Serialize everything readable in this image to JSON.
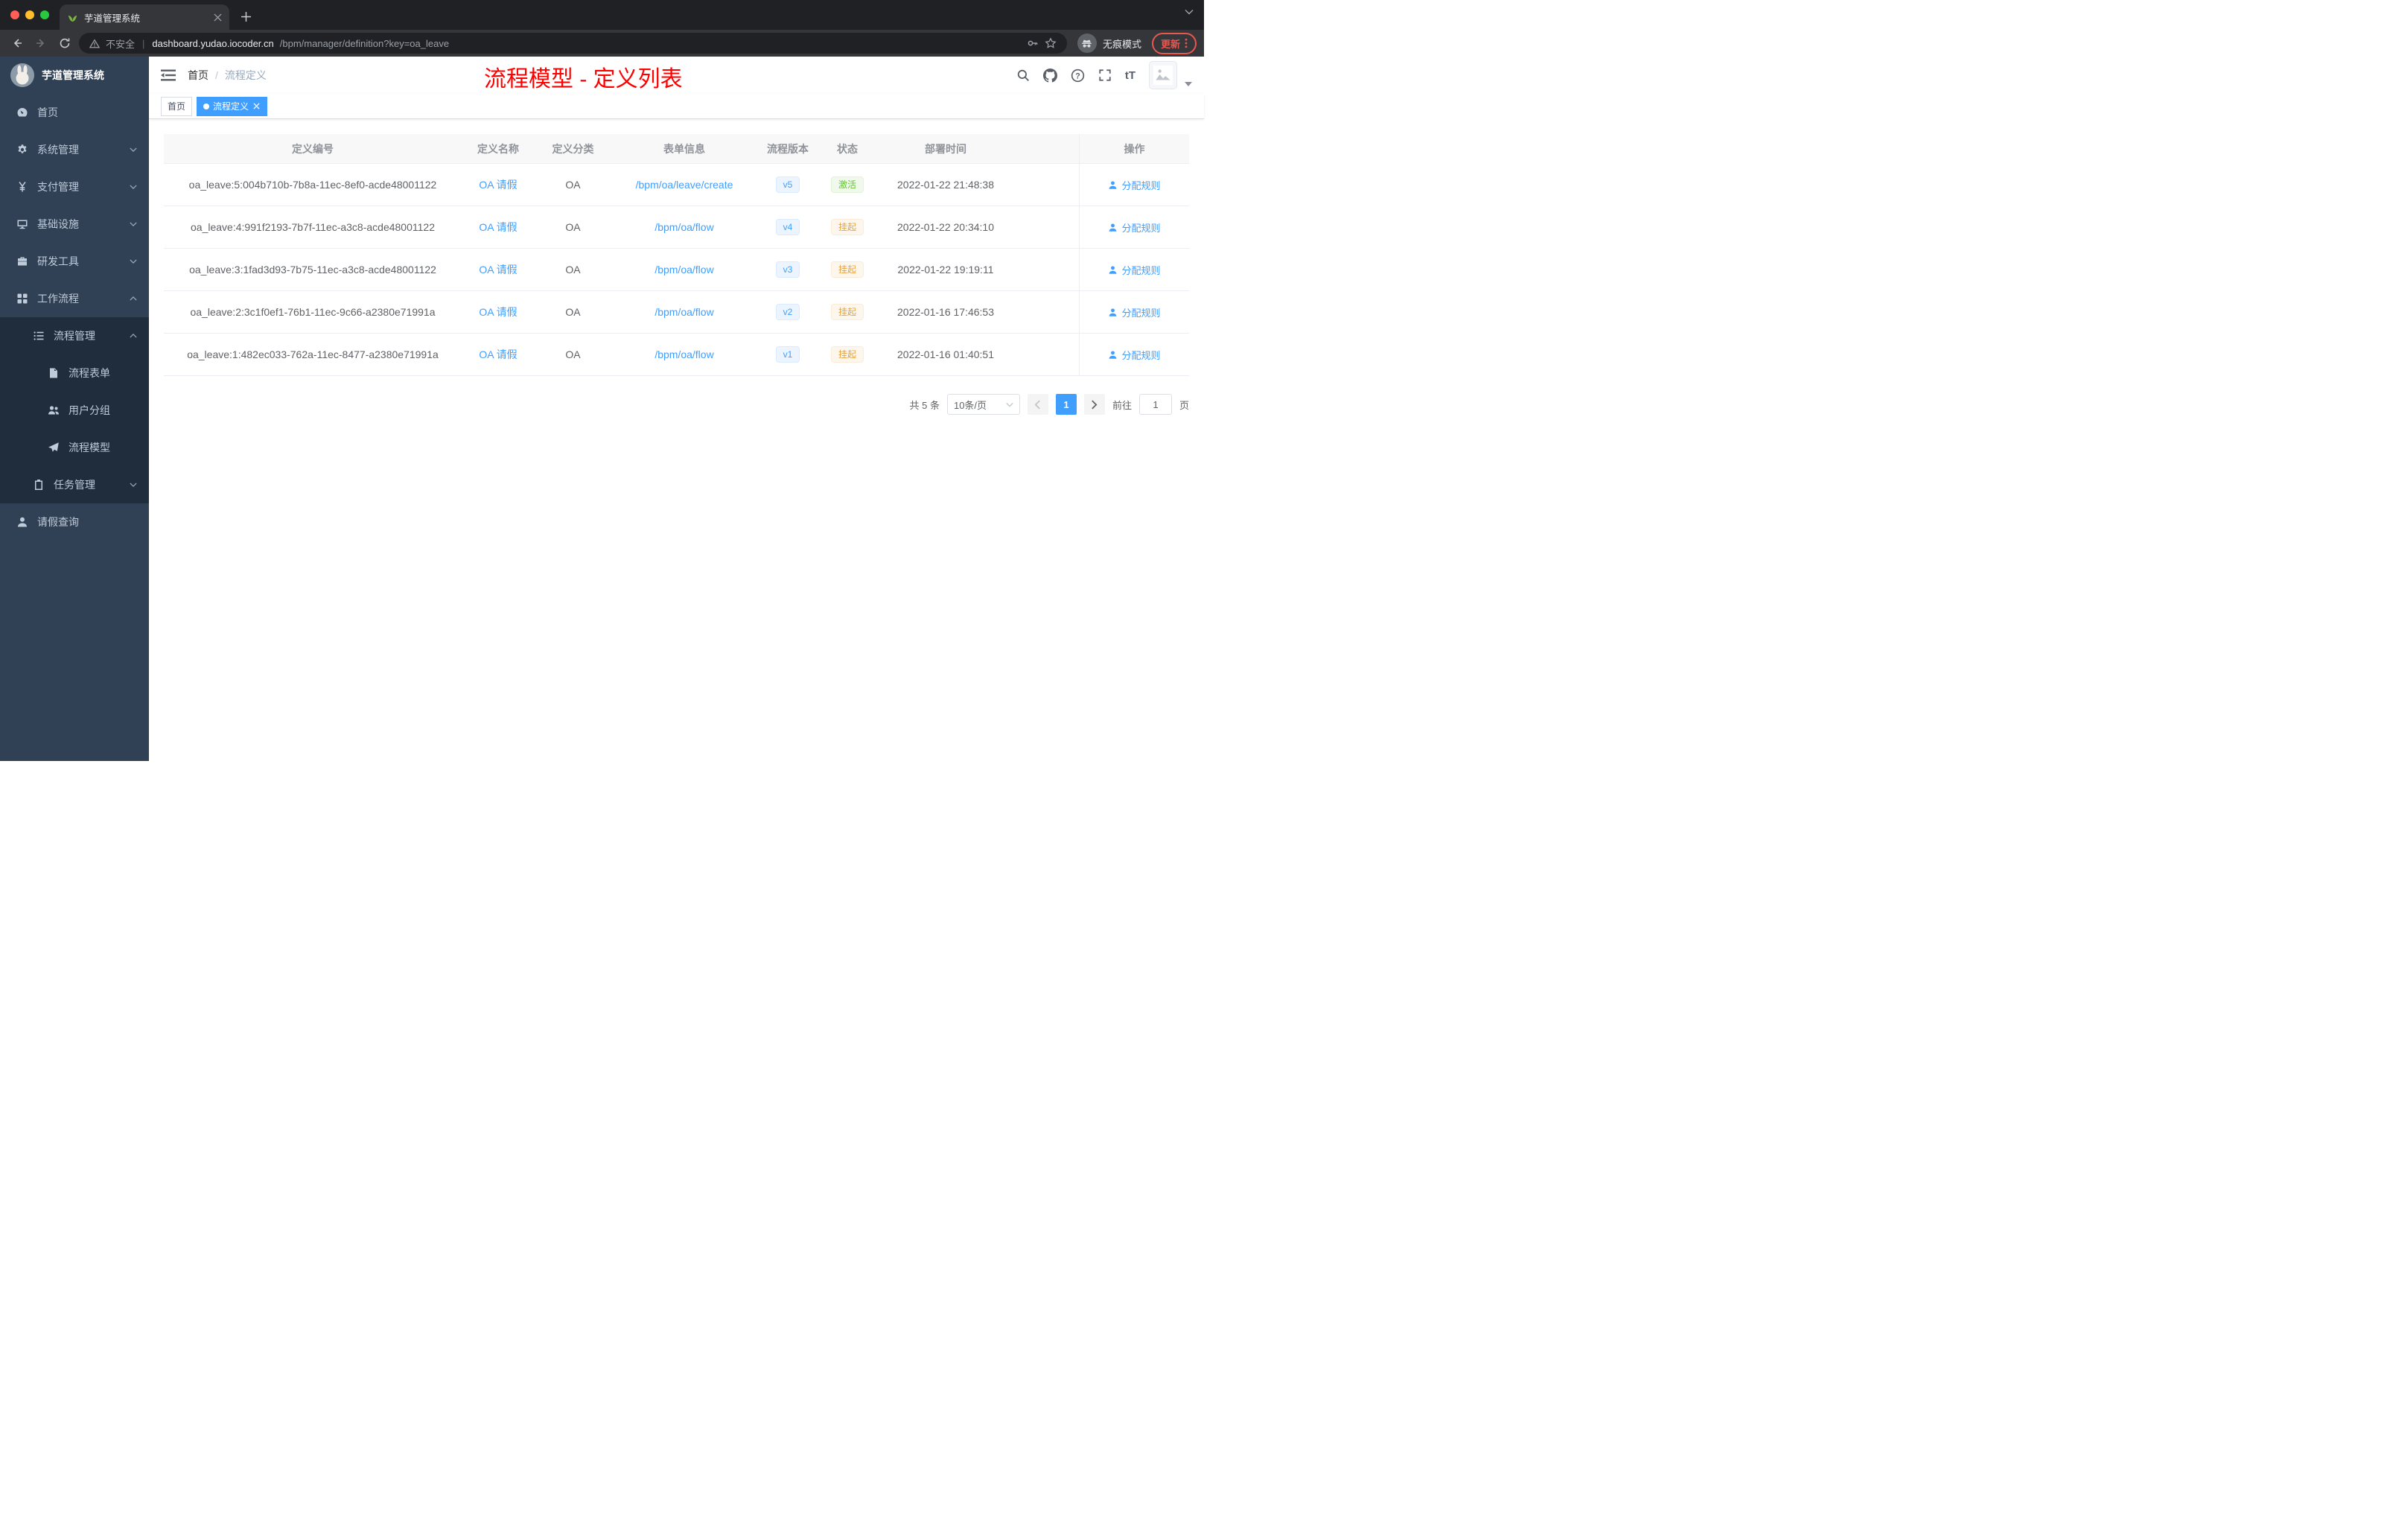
{
  "colors": {
    "accent": "#409eff",
    "success": "#67c23a",
    "warning": "#e6a23c",
    "annotation_red": "#ff0000",
    "sidebar_bg": "#304156",
    "sidebar_sub_bg": "#1f2d3d"
  },
  "browser": {
    "tab": {
      "title": "芋道管理系统"
    },
    "toolbar": {
      "security_label": "不安全",
      "url_host": "dashboard.yudao.iocoder.cn",
      "url_path": "/bpm/manager/definition?key=oa_leave",
      "incognito_label": "无痕模式",
      "update_label": "更新"
    }
  },
  "sidebar": {
    "logo_title": "芋道管理系统",
    "items": [
      {
        "label": "首页",
        "icon": "dashboard-icon",
        "level": 1
      },
      {
        "label": "系统管理",
        "icon": "gear-icon",
        "level": 1,
        "chevron": "down"
      },
      {
        "label": "支付管理",
        "icon": "yen-icon",
        "level": 1,
        "chevron": "down"
      },
      {
        "label": "基础设施",
        "icon": "monitor-icon",
        "level": 1,
        "chevron": "down"
      },
      {
        "label": "研发工具",
        "icon": "toolbox-icon",
        "level": 1,
        "chevron": "down"
      },
      {
        "label": "工作流程",
        "icon": "grid-icon",
        "level": 1,
        "chevron": "up"
      },
      {
        "label": "流程管理",
        "icon": "list-icon",
        "level": 2,
        "chevron": "up"
      },
      {
        "label": "流程表单",
        "icon": "document-icon",
        "level": 3
      },
      {
        "label": "用户分组",
        "icon": "users-icon",
        "level": 3
      },
      {
        "label": "流程模型",
        "icon": "send-icon",
        "level": 3
      },
      {
        "label": "任务管理",
        "icon": "clipboard-icon",
        "level": 2,
        "chevron": "down"
      },
      {
        "label": "请假查询",
        "icon": "user-icon",
        "level": 1
      }
    ]
  },
  "navbar": {
    "breadcrumb": {
      "home": "首页",
      "separator": "/",
      "current": "流程定义"
    },
    "annotation": "流程模型 - 定义列表",
    "font_size_label": "tT"
  },
  "tags": {
    "items": [
      {
        "label": "首页",
        "active": false
      },
      {
        "label": "流程定义",
        "active": true,
        "closable": true
      }
    ]
  },
  "table": {
    "columns": [
      "定义编号",
      "定义名称",
      "定义分类",
      "表单信息",
      "流程版本",
      "状态",
      "部署时间",
      "操作"
    ],
    "rows": [
      {
        "id": "oa_leave:5:004b710b-7b8a-11ec-8ef0-acde48001122",
        "name": "OA 请假",
        "category": "OA",
        "form": "/bpm/oa/leave/create",
        "version": "v5",
        "status": "激活",
        "status_type": "success",
        "time": "2022-01-22 21:48:38",
        "action": "分配规则"
      },
      {
        "id": "oa_leave:4:991f2193-7b7f-11ec-a3c8-acde48001122",
        "name": "OA 请假",
        "category": "OA",
        "form": "/bpm/oa/flow",
        "version": "v4",
        "status": "挂起",
        "status_type": "warning",
        "time": "2022-01-22 20:34:10",
        "action": "分配规则"
      },
      {
        "id": "oa_leave:3:1fad3d93-7b75-11ec-a3c8-acde48001122",
        "name": "OA 请假",
        "category": "OA",
        "form": "/bpm/oa/flow",
        "version": "v3",
        "status": "挂起",
        "status_type": "warning",
        "time": "2022-01-22 19:19:11",
        "action": "分配规则"
      },
      {
        "id": "oa_leave:2:3c1f0ef1-76b1-11ec-9c66-a2380e71991a",
        "name": "OA 请假",
        "category": "OA",
        "form": "/bpm/oa/flow",
        "version": "v2",
        "status": "挂起",
        "status_type": "warning",
        "time": "2022-01-16 17:46:53",
        "action": "分配规则"
      },
      {
        "id": "oa_leave:1:482ec033-762a-11ec-8477-a2380e71991a",
        "name": "OA 请假",
        "category": "OA",
        "form": "/bpm/oa/flow",
        "version": "v1",
        "status": "挂起",
        "status_type": "warning",
        "time": "2022-01-16 01:40:51",
        "action": "分配规则"
      }
    ]
  },
  "pagination": {
    "total": "共 5 条",
    "page_size": "10条/页",
    "current_page": "1",
    "goto_label": "前往",
    "goto_value": "1",
    "page_unit": "页"
  }
}
